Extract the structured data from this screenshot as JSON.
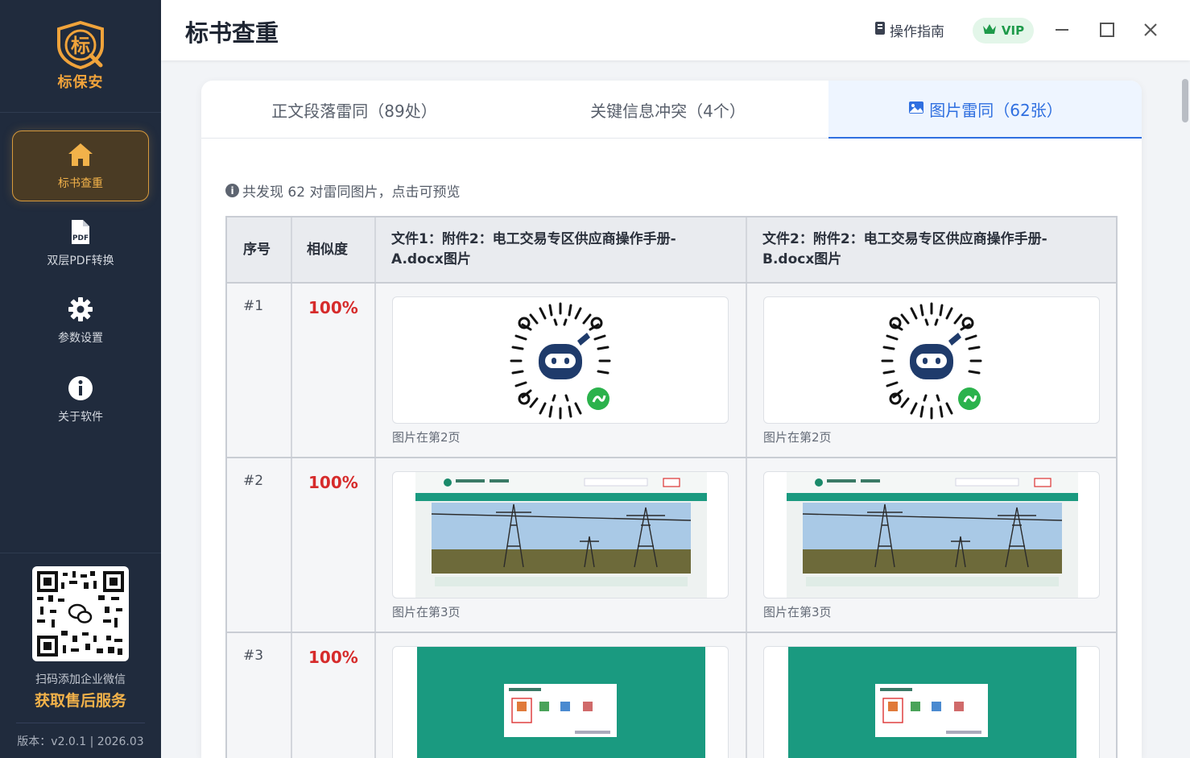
{
  "app": {
    "logo_text": "标保安",
    "logo_glyph": "标"
  },
  "sidebar": {
    "items": [
      {
        "label": "标书查重",
        "icon": "home-icon",
        "active": true
      },
      {
        "label": "双层PDF转换",
        "icon": "pdf-file-icon",
        "active": false
      },
      {
        "label": "参数设置",
        "icon": "gear-icon",
        "active": false
      },
      {
        "label": "关于软件",
        "icon": "info-icon",
        "active": false
      }
    ],
    "qr_caption": "扫码添加企业微信",
    "qr_strong": "获取售后服务",
    "version": "版本：v2.0.1 | 2026.03"
  },
  "header": {
    "title": "标书查重",
    "guide_label": "操作指南",
    "vip_label": "VIP"
  },
  "tabs": [
    {
      "label": "正文段落雷同（89处）",
      "active": false
    },
    {
      "label": "关键信息冲突（4个）",
      "active": false
    },
    {
      "label": "图片雷同（62张）",
      "active": true
    }
  ],
  "info_text": "共发现 62 对雷同图片，点击可预览",
  "table": {
    "headers": {
      "index": "序号",
      "similarity": "相似度",
      "file1_line1": "文件1：附件2：电工交易专区供应商操作手册-",
      "file1_line2": "A.docx图片",
      "file2_line1": "文件2：附件2：电工交易专区供应商操作手册-",
      "file2_line2": "B.docx图片"
    },
    "rows": [
      {
        "index": "#1",
        "similarity": "100%",
        "file1_caption": "图片在第2页",
        "file2_caption": "图片在第2页"
      },
      {
        "index": "#2",
        "similarity": "100%",
        "file1_caption": "图片在第3页",
        "file2_caption": "图片在第3页"
      },
      {
        "index": "#3",
        "similarity": "100%",
        "file1_caption": "",
        "file2_caption": ""
      }
    ]
  },
  "colors": {
    "accent": "#2f6fe0",
    "sidebar_bg": "#202b3d",
    "gold": "#f2b24a",
    "danger": "#d62b2b",
    "teal": "#1a9a80"
  }
}
